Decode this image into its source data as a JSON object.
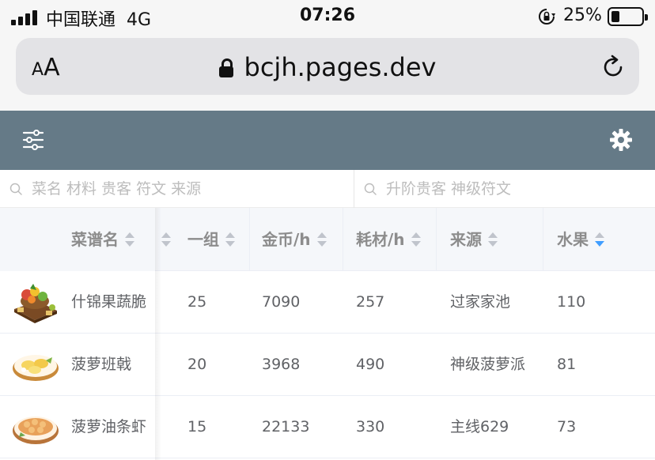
{
  "status_bar": {
    "carrier": "中国联通",
    "network": "4G",
    "time": "07:26",
    "battery": "25%",
    "battery_level": 0.25
  },
  "browser": {
    "text_size_label_small": "A",
    "text_size_label_large": "A",
    "url": "bcjh.pages.dev"
  },
  "app_header": {
    "bg_color": "#657a87"
  },
  "search": {
    "main_placeholder": "菜名 材料 贵客 符文 来源",
    "secondary_placeholder": "升阶贵客 神级符文"
  },
  "table": {
    "columns": [
      {
        "label": "菜谱名",
        "sort": "none"
      },
      {
        "label": "",
        "sort": "none"
      },
      {
        "label": "一组",
        "sort": "none"
      },
      {
        "label": "金币/h",
        "sort": "none"
      },
      {
        "label": "耗材/h",
        "sort": "none"
      },
      {
        "label": "来源",
        "sort": "none"
      },
      {
        "label": "水果",
        "sort": "descending"
      }
    ],
    "rows": [
      {
        "name": "什锦果蔬脆",
        "icon": "mixed-fruit-crisp-dish-icon",
        "group": "25",
        "gold": "7090",
        "cost": "257",
        "source": "过家家池",
        "fruit": "110"
      },
      {
        "name": "菠萝班戟",
        "icon": "pineapple-pancake-dish-icon",
        "group": "20",
        "gold": "3968",
        "cost": "490",
        "source": "神级菠萝派",
        "fruit": "81"
      },
      {
        "name": "菠萝油条虾",
        "icon": "pineapple-shrimp-dish-icon",
        "group": "15",
        "gold": "22133",
        "cost": "330",
        "source": "主线629",
        "fruit": "73"
      }
    ],
    "sort_active_color": "#409eff"
  }
}
